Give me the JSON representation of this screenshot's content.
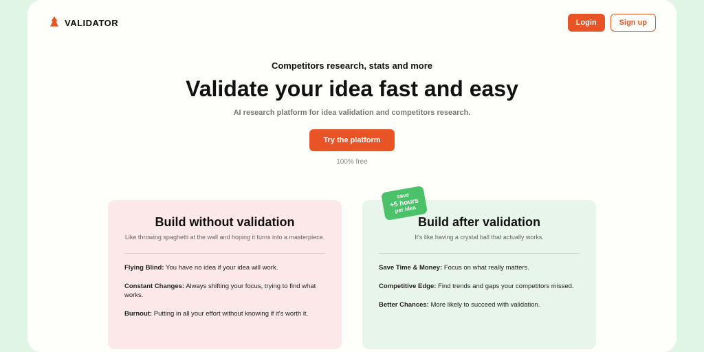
{
  "brand": {
    "name": "VALIDATOR"
  },
  "nav": {
    "login": "Login",
    "signup": "Sign up"
  },
  "hero": {
    "subtitle": "Competitors research, stats and more",
    "title": "Validate your idea fast and easy",
    "tagline": "AI research platform for idea validation and competitors research.",
    "cta": "Try the platform",
    "note": "100% free"
  },
  "badge": {
    "line1": "save",
    "line2": "+5 hours",
    "line3": "per idea"
  },
  "left": {
    "title": "Build without validation",
    "sub": "Like throwing spaghetti at the wall and hoping it turns into a masterpiece.",
    "points": [
      {
        "b": "Flying Blind:",
        "t": " You have no idea if your idea will work."
      },
      {
        "b": "Constant Changes:",
        "t": " Always shifting your focus, trying to find what works."
      },
      {
        "b": "Burnout:",
        "t": " Putting in all your effort without knowing if it's worth it."
      }
    ]
  },
  "right": {
    "title": "Build after validation",
    "sub": "It's like having a crystal ball that actually works.",
    "points": [
      {
        "b": "Save Time & Money:",
        "t": " Focus on what really matters."
      },
      {
        "b": "Competitive Edge:",
        "t": " Find trends and gaps your competitors missed."
      },
      {
        "b": "Better Chances:",
        "t": " More likely to succeed with validation."
      }
    ]
  }
}
